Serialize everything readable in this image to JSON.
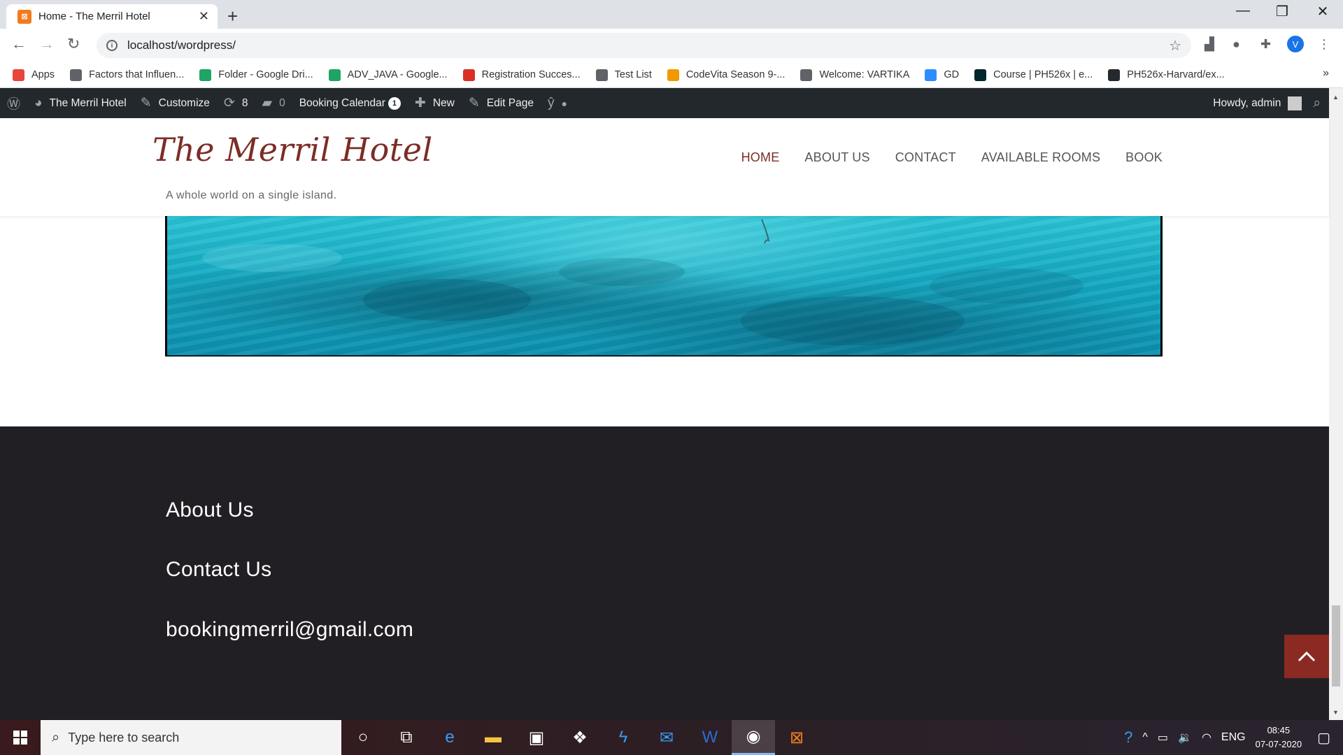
{
  "browser": {
    "tab_title": "Home - The Merril Hotel",
    "url": "localhost/wordpress/",
    "profile_initial": "V"
  },
  "bookmarks": [
    {
      "label": "Apps",
      "color": "#e8453c"
    },
    {
      "label": "Factors that Influen...",
      "color": "#5f6368"
    },
    {
      "label": "Folder - Google Dri...",
      "color": "#1fa463"
    },
    {
      "label": "ADV_JAVA - Google...",
      "color": "#1fa463"
    },
    {
      "label": "Registration Succes...",
      "color": "#d93025"
    },
    {
      "label": "Test List",
      "color": "#5f6368"
    },
    {
      "label": "CodeVita Season 9-...",
      "color": "#f29900"
    },
    {
      "label": "Welcome: VARTIKA",
      "color": "#5f6368"
    },
    {
      "label": "GD",
      "color": "#2d8cff"
    },
    {
      "label": "Course | PH526x | e...",
      "color": "#02262b"
    },
    {
      "label": "PH526x-Harvard/ex...",
      "color": "#24292e"
    }
  ],
  "adminbar": {
    "site_name": "The Merril Hotel",
    "customize": "Customize",
    "updates_count": "8",
    "comments_count": "0",
    "booking_calendar": "Booking Calendar",
    "booking_badge": "1",
    "new": "New",
    "edit_page": "Edit Page",
    "howdy": "Howdy, admin"
  },
  "site": {
    "title": "The Merril Hotel",
    "tagline": "A whole world on a single island.",
    "nav": [
      "HOME",
      "ABOUT US",
      "CONTACT",
      "AVAILABLE ROOMS",
      "BOOK"
    ],
    "active_nav": "HOME"
  },
  "footer": {
    "about": "About Us",
    "contact": "Contact Us",
    "email": "bookingmerril@gmail.com"
  },
  "taskbar": {
    "search_placeholder": "Type here to search",
    "language": "ENG",
    "time": "08:45",
    "date": "07-07-2020"
  },
  "colors": {
    "accent": "#7b2d26",
    "footer_bg": "#221f24",
    "scroll_top_bg": "#8b2a22",
    "adminbar_bg": "#23282d"
  }
}
